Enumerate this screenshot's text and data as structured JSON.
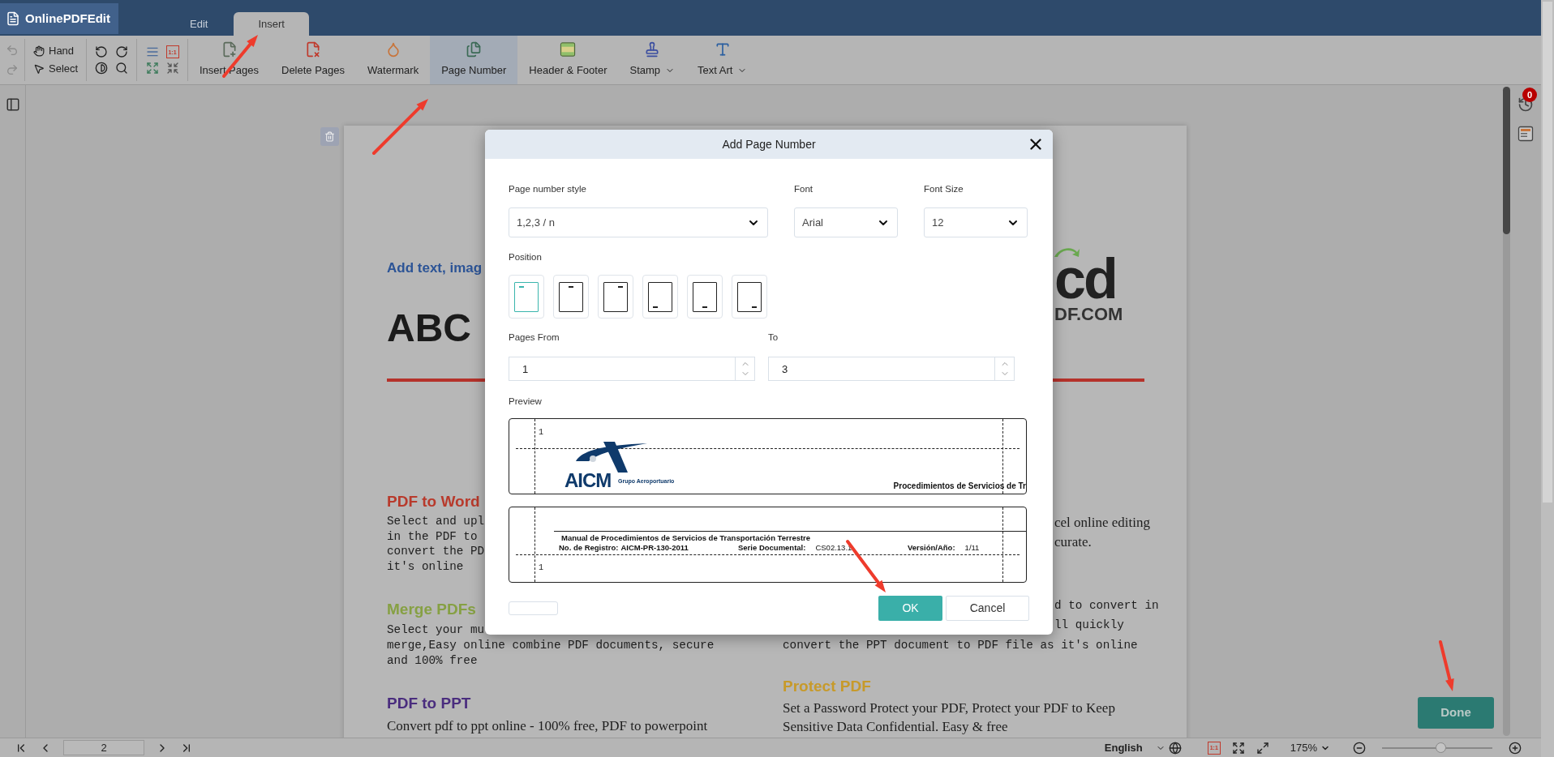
{
  "app": {
    "logo": "OnlinePDFEdit"
  },
  "tabs": [
    {
      "label": "Edit",
      "selected": false
    },
    {
      "label": "Insert",
      "selected": true
    }
  ],
  "toolbar": {
    "history": [
      {
        "kind": "undo",
        "disabled": true
      },
      {
        "kind": "redo",
        "disabled": true
      }
    ],
    "modes": [
      {
        "label": "Hand",
        "kind": "hand"
      },
      {
        "label": "Select",
        "kind": "select"
      }
    ],
    "actual_size": "1:1",
    "actions": [
      {
        "label": "Insert Pages",
        "kind": "insert",
        "selected": false,
        "dropdown": false
      },
      {
        "label": "Delete Pages",
        "kind": "delete",
        "selected": false,
        "dropdown": false
      },
      {
        "label": "Watermark",
        "kind": "watermark",
        "selected": false,
        "dropdown": false
      },
      {
        "label": "Page Number",
        "kind": "number",
        "selected": true,
        "dropdown": false
      },
      {
        "label": "Header & Footer",
        "kind": "header",
        "selected": false,
        "dropdown": false
      },
      {
        "label": "Stamp",
        "kind": "stamp",
        "selected": false,
        "dropdown": true
      },
      {
        "label": "Text Art",
        "kind": "text-art",
        "selected": false,
        "dropdown": true
      }
    ]
  },
  "page": {
    "top_left": [
      {
        "kind": "lead",
        "text": "Add text, imag"
      },
      {
        "kind": "display",
        "text": "ABC"
      }
    ],
    "top_right": [
      {
        "kind": "logo",
        "text": "cd"
      },
      {
        "kind": "logo_sub",
        "text": "DF.COM"
      }
    ],
    "mid_left": [
      {
        "kind": "heading",
        "text": "PDF to Word",
        "color": "#b83a2c"
      },
      {
        "kind": "mono",
        "text": "Select and upl"
      },
      {
        "kind": "mono",
        "text": "in the PDF to"
      },
      {
        "kind": "mono",
        "text": "convert the PD"
      },
      {
        "kind": "mono",
        "text": "it's online"
      },
      {
        "kind": "heading",
        "text": "Merge PDFs",
        "color": "#86a043"
      },
      {
        "kind": "mono",
        "text": "Select your mu"
      }
    ],
    "mid_right": [
      {
        "kind": "serif",
        "text": "cel online editing"
      },
      {
        "kind": "serif",
        "text": "curate."
      },
      {
        "kind": "mono",
        "text": "d to convert in"
      },
      {
        "kind": "mono",
        "text": "ll quickly"
      }
    ],
    "bottom_left": [
      {
        "kind": "mono",
        "text": "merge,Easy online combine PDF documents, secure"
      },
      {
        "kind": "mono",
        "text": "and 100% free"
      },
      {
        "kind": "heading",
        "text": "PDF to PPT",
        "color": "#4a2d7e"
      },
      {
        "kind": "serif",
        "text": "Convert pdf to ppt online - 100% free, PDF to powerpoint"
      }
    ],
    "bottom_right": [
      {
        "kind": "mono",
        "text": "convert the PPT document to PDF file as it's online"
      },
      {
        "kind": "heading",
        "text": "Protect PDF",
        "color": "#c79a2a"
      },
      {
        "kind": "serif",
        "text": "Set a Password Protect your PDF, Protect your PDF to Keep"
      },
      {
        "kind": "serif",
        "text": "Sensitive Data Confidential. Easy & free"
      }
    ]
  },
  "dialog": {
    "title": "Add Page Number",
    "style": {
      "label": "Page number style",
      "value": "1,2,3 / n"
    },
    "font": {
      "label": "Font",
      "value": "Arial"
    },
    "font_size": {
      "label": "Font Size",
      "value": "12"
    },
    "position": {
      "label": "Position",
      "options": [
        {
          "kind": "top-left",
          "selected": true
        },
        {
          "kind": "top-center",
          "selected": false
        },
        {
          "kind": "top-right",
          "selected": false
        },
        {
          "kind": "bottom-left",
          "selected": false
        },
        {
          "kind": "bottom-center",
          "selected": false
        },
        {
          "kind": "bottom-right",
          "selected": false
        }
      ]
    },
    "pages_from": {
      "label": "Pages From",
      "value": "1"
    },
    "pages_to": {
      "label": "To",
      "value": "3"
    },
    "preview": {
      "label": "Preview",
      "header": {
        "number": "1",
        "logo": "AICM",
        "logo_caption": "Grupo Aeroportuario",
        "title": "Procedimientos de Servicios de Tr"
      },
      "footer": {
        "title": "Manual de Procedimientos de Servicios de Transportación Terrestre",
        "fields": [
          {
            "label": "No. de Registro:",
            "value": "AICM-PR-130-2011",
            "bold_value": true
          },
          {
            "label": "Serie Documental:",
            "value": "CS02.13.1",
            "bold_value": false
          },
          {
            "label": "Versión/Año:",
            "value": "1/11",
            "bold_value": false
          }
        ],
        "number": "1"
      }
    },
    "buttons": [
      {
        "label": "OK",
        "kind": "primary"
      },
      {
        "label": "Cancel",
        "kind": "secondary"
      }
    ]
  },
  "right_rail": {
    "notifications": "0"
  },
  "done_button": "Done",
  "status_bar": {
    "page": "2",
    "language": "English",
    "actual_size": "1:1",
    "zoom": "175%",
    "zoom_slider": {
      "level": 0.53
    }
  }
}
